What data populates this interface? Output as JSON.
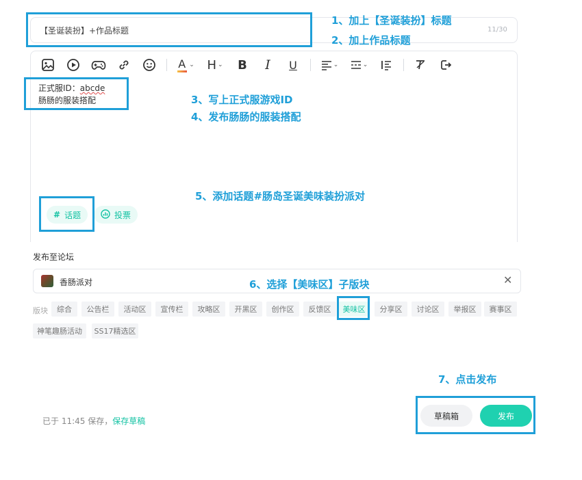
{
  "title_field": {
    "value": "【圣诞装扮】+作品标题",
    "count": "11/30"
  },
  "toolbar": {
    "icons": [
      "image-icon",
      "video-icon",
      "gamepad-icon",
      "link-icon",
      "emoji-icon",
      "font-color-icon",
      "heading-icon",
      "bold-icon",
      "italic-icon",
      "underline-icon",
      "align-icon",
      "divider-icon",
      "list-icon",
      "clear-format-icon",
      "redo-icon"
    ],
    "font_color_label": "A",
    "heading_label": "H",
    "bold_label": "B",
    "italic_label": "I",
    "underline_label": "U",
    "accent_color": "#1fd1b0"
  },
  "editor": {
    "line1_prefix": "正式服ID：",
    "line1_value": "abcde",
    "line2": "肠肠的服装搭配"
  },
  "chips": {
    "topic": "话题",
    "topic_icon": "#",
    "vote": "投票"
  },
  "forum": {
    "label": "发布至论坛",
    "selected": "香肠派对",
    "close": "✕",
    "section_label": "版块",
    "sections": [
      "综合",
      "公告栏",
      "活动区",
      "宣传栏",
      "攻略区",
      "开黑区",
      "创作区",
      "反馈区",
      "美味区",
      "分享区",
      "讨论区",
      "举报区",
      "赛事区",
      "神笔趣肠活动",
      "SS17精选区"
    ],
    "active_section": "美味区"
  },
  "footer": {
    "saved_prefix": "已于 11:45 保存，",
    "saved_link": "保存草稿",
    "draft_button": "草稿箱",
    "publish_button": "发布"
  },
  "annotations": {
    "n1": "1、加上【圣诞装扮】标题",
    "n2": "2、加上作品标题",
    "n3": "3、写上正式服游戏ID",
    "n4": "4、发布肠肠的服装搭配",
    "n5": "5、添加话题#肠岛圣诞美味装扮派对",
    "n6": "6、选择【美味区】子版块",
    "n7": "7、点击发布",
    "color": "#1f9fd8"
  }
}
